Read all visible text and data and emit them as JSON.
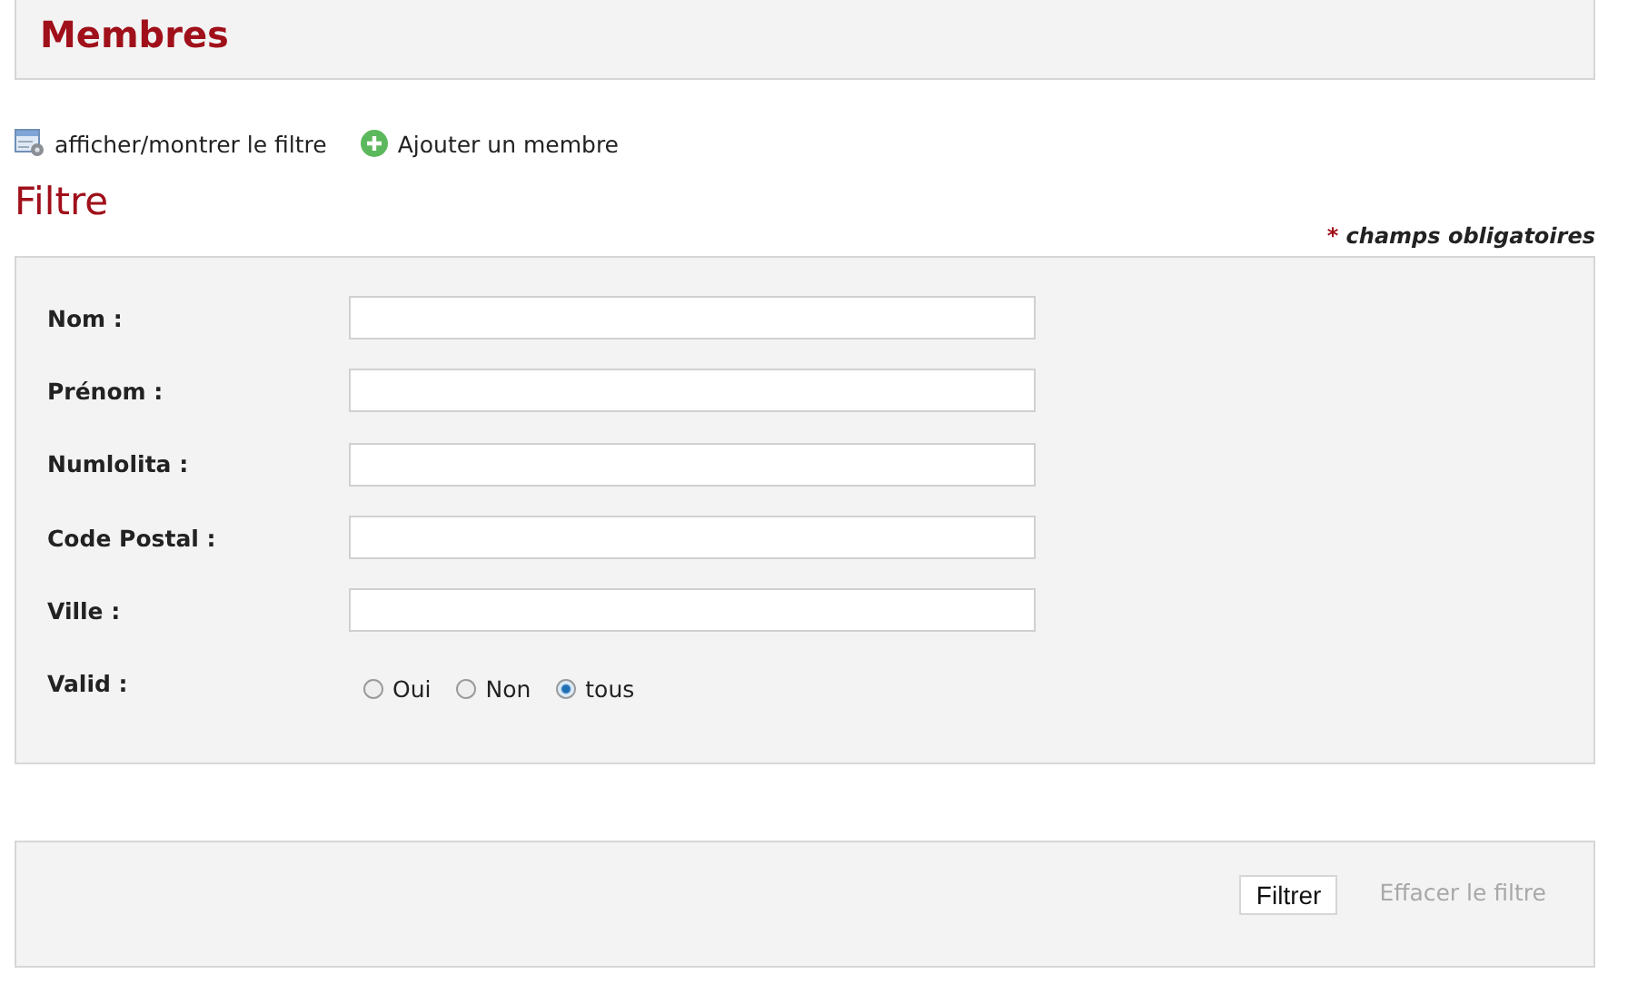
{
  "header": {
    "title": "Membres"
  },
  "toolbar": [
    {
      "label": "afficher/montrer le filtre",
      "kind": "toggle"
    },
    {
      "label": "Ajouter un membre",
      "kind": "add"
    }
  ],
  "section_title": "Filtre",
  "required_note": {
    "mark": "*",
    "text": "champs obligatoires"
  },
  "form": {
    "fields": [
      {
        "label": "Nom :",
        "kind": "text"
      },
      {
        "label": "Prénom :",
        "kind": "text"
      },
      {
        "label": "Numlolita :",
        "kind": "text"
      },
      {
        "label": "Code Postal :",
        "kind": "text"
      },
      {
        "label": "Ville :",
        "kind": "text"
      },
      {
        "label": "Valid :",
        "kind": "radio",
        "options": [
          {
            "label": "Oui",
            "selected": false
          },
          {
            "label": "Non",
            "selected": false
          },
          {
            "label": "tous",
            "selected": true
          }
        ]
      }
    ]
  },
  "actions": [
    {
      "label": "Filtrer",
      "disabled": false
    },
    {
      "label": "Effacer le filtre",
      "disabled": true
    }
  ]
}
